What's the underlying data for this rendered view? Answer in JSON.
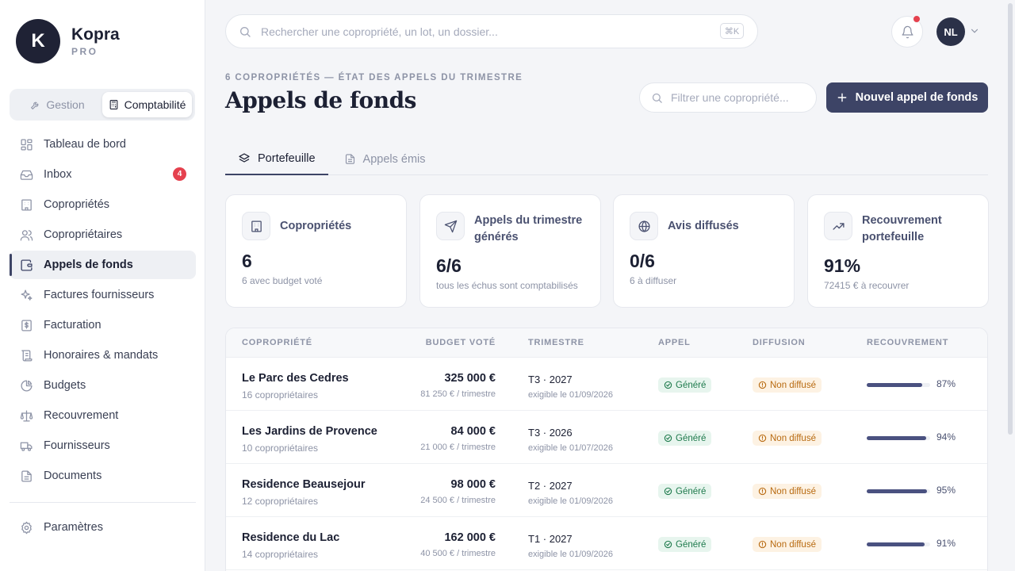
{
  "brand": {
    "logo_letter": "K",
    "name": "Kopra",
    "tier": "PRO"
  },
  "mode_switch": [
    {
      "label": "Gestion",
      "icon": "wrench-icon",
      "active": false
    },
    {
      "label": "Comptabilité",
      "icon": "calculator-icon",
      "active": true
    }
  ],
  "nav": [
    {
      "label": "Tableau de bord",
      "icon": "dashboard-icon"
    },
    {
      "label": "Inbox",
      "icon": "inbox-icon",
      "badge": "4"
    },
    {
      "label": "Copropriétés",
      "icon": "building-icon"
    },
    {
      "label": "Copropriétaires",
      "icon": "users-icon"
    },
    {
      "label": "Appels de fonds",
      "icon": "wallet-icon",
      "active": true
    },
    {
      "label": "Factures fournisseurs",
      "icon": "sparkles-icon"
    },
    {
      "label": "Facturation",
      "icon": "receipt-dollar-icon"
    },
    {
      "label": "Honoraires & mandats",
      "icon": "scroll-icon"
    },
    {
      "label": "Budgets",
      "icon": "pie-chart-icon"
    },
    {
      "label": "Recouvrement",
      "icon": "scale-icon"
    },
    {
      "label": "Fournisseurs",
      "icon": "truck-icon"
    },
    {
      "label": "Documents",
      "icon": "document-icon"
    }
  ],
  "settings_label": "Paramètres",
  "search": {
    "placeholder": "Rechercher une copropriété, un lot, un dossier...",
    "shortcut": "⌘K"
  },
  "user": {
    "initials": "NL"
  },
  "header": {
    "eyebrow": "6 COPROPRIÉTÉS — ÉTAT DES APPELS DU TRIMESTRE",
    "title": "Appels de fonds",
    "filter_placeholder": "Filtrer une copropriété...",
    "new_button": "Nouvel appel de fonds"
  },
  "tabs": [
    {
      "label": "Portefeuille",
      "icon": "layers-icon",
      "active": true
    },
    {
      "label": "Appels émis",
      "icon": "document-icon",
      "active": false
    }
  ],
  "stats": [
    {
      "label": "Copropriétés",
      "value": "6",
      "sub": "6 avec budget voté",
      "icon": "building-icon"
    },
    {
      "label": "Appels du trimestre générés",
      "value": "6/6",
      "sub": "tous les échus sont comptabilisés",
      "icon": "send-icon"
    },
    {
      "label": "Avis diffusés",
      "value": "0/6",
      "sub": "6 à diffuser",
      "icon": "globe-icon"
    },
    {
      "label": "Recouvrement portefeuille",
      "value": "91%",
      "sub": "72415 € à recouvrer",
      "icon": "trend-up-icon"
    }
  ],
  "table": {
    "headers": {
      "copropriete": "COPROPRIÉTÉ",
      "budget": "BUDGET VOTÉ",
      "trimestre": "TRIMESTRE",
      "appel": "APPEL",
      "diffusion": "DIFFUSION",
      "recouvrement": "RECOUVREMENT"
    },
    "rows": [
      {
        "name": "Le Parc des Cedres",
        "owners": "16 copropriétaires",
        "budget": "325 000 €",
        "budget_sub": "81 250 € / trimestre",
        "quarter": "T3 · 2027",
        "due": "exigible le 01/09/2026",
        "appel": "Généré",
        "diffusion": "Non diffusé",
        "recovery": 0.87,
        "recovery_label": "87%"
      },
      {
        "name": "Les Jardins de Provence",
        "owners": "10 copropriétaires",
        "budget": "84 000 €",
        "budget_sub": "21 000 € / trimestre",
        "quarter": "T3 · 2026",
        "due": "exigible le 01/07/2026",
        "appel": "Généré",
        "diffusion": "Non diffusé",
        "recovery": 0.94,
        "recovery_label": "94%"
      },
      {
        "name": "Residence Beausejour",
        "owners": "12 copropriétaires",
        "budget": "98 000 €",
        "budget_sub": "24 500 € / trimestre",
        "quarter": "T2 · 2027",
        "due": "exigible le 01/09/2026",
        "appel": "Généré",
        "diffusion": "Non diffusé",
        "recovery": 0.95,
        "recovery_label": "95%"
      },
      {
        "name": "Residence du Lac",
        "owners": "14 copropriétaires",
        "budget": "162 000 €",
        "budget_sub": "40 500 € / trimestre",
        "quarter": "T1 · 2027",
        "due": "exigible le 01/09/2026",
        "appel": "Généré",
        "diffusion": "Non diffusé",
        "recovery": 0.91,
        "recovery_label": "91%"
      }
    ]
  }
}
